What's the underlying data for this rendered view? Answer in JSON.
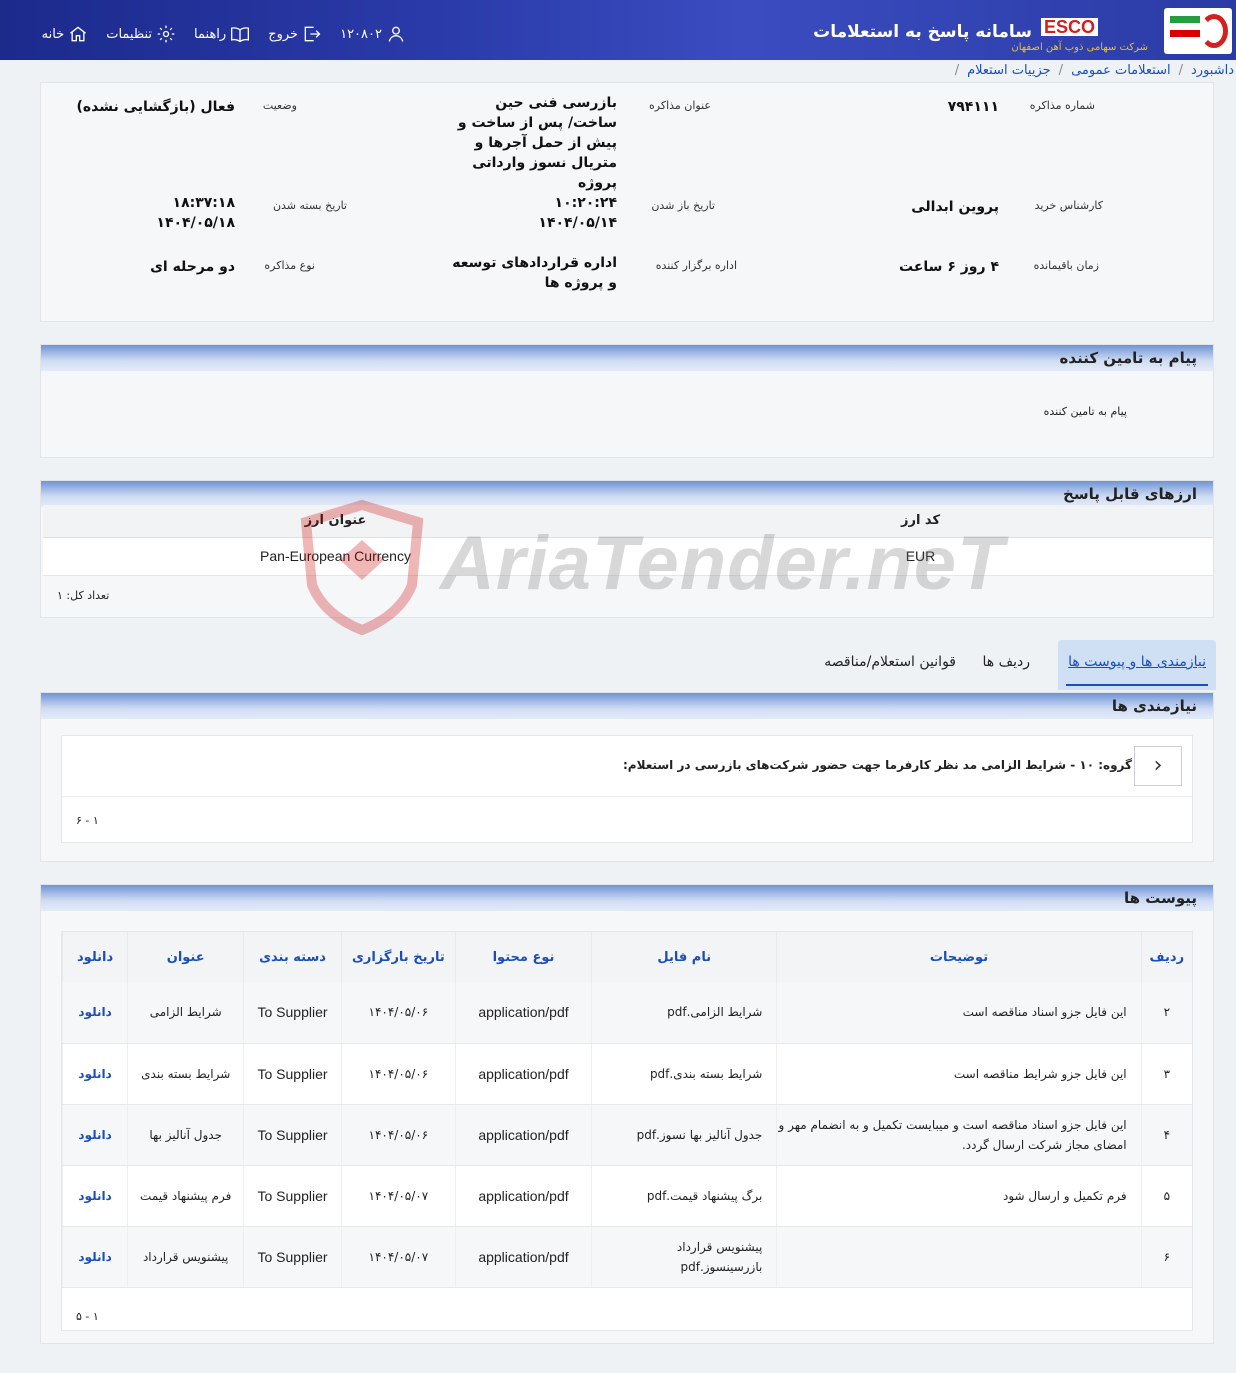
{
  "header": {
    "system_title": "سامانه پاسخ به استعلامات",
    "brand": "ESCO",
    "brand_sub": "شرکت سهامی ذوب آهن اصفهان",
    "nav": {
      "home": "خانه",
      "settings": "تنظیمات",
      "guide": "راهنما",
      "logout": "خروج",
      "user_id": "۱۲۰۸۰۲"
    }
  },
  "breadcrumb": {
    "dashboard": "داشبورد",
    "public": "استعلامات عمومی",
    "detail": "جزییات استعلام"
  },
  "detail": {
    "number_label": "شماره مذاکره",
    "number_value": "۷۹۴۱۱۱",
    "title_label": "عنوان مذاکره",
    "title_value": "بازرسی فنی حین ساخت/ پس از ساخت و پیش از حمل آجرها و متریال نسوز وارداتی پروژه",
    "status_label": "وضعیت",
    "status_value": "فعال (بازگشایی نشده)",
    "expert_label": "کارشناس خرید",
    "expert_value": "پروین ابدالی",
    "open_label": "تاریخ باز شدن",
    "open_time": "۱۰:۲۰:۲۴",
    "open_date": "۱۴۰۴/۰۵/۱۴",
    "close_label": "تاریخ بسته شدن",
    "close_time": "۱۸:۳۷:۱۸",
    "close_date": "۱۴۰۴/۰۵/۱۸",
    "remain_label": "زمان باقیمانده",
    "remain_value": "۴ روز ۶ ساعت",
    "org_label": "اداره برگزار کننده",
    "org_value": "اداره قراردادهای توسعه و پروژه ها",
    "type_label": "نوع مذاکره",
    "type_value": "دو مرحله ای"
  },
  "message": {
    "title": "پیام به تامین کننده",
    "label": "پیام به تامین کننده"
  },
  "currencies": {
    "title": "ارزهای قابل پاسخ",
    "col_code": "کد ارز",
    "col_title": "عنوان ارز",
    "rows": [
      {
        "code": "EUR",
        "title": "Pan-European Currency"
      }
    ],
    "count": "تعداد کل: ۱"
  },
  "tabs": {
    "needs": "نیازمندی ها و پیوست ها",
    "rows": "ردیف ها",
    "rules": "قوانین استعلام/مناقصه"
  },
  "needs": {
    "title": "نیازمندی ها",
    "group": "گروه: ۱۰ - شرایط الزامی مد نظر کارفرما جهت حضور شرکت‌های بازرسی در استعلام:",
    "pager": "۱ - ۶"
  },
  "attachments": {
    "title": "پیوست ها",
    "columns": {
      "row": "ردیف",
      "desc": "توضیحات",
      "name": "نام فایل",
      "mime": "نوع محتوا",
      "date": "تاریخ بارگزاری",
      "cat": "دسته بندی",
      "title": "عنوان",
      "dl": "دانلود"
    },
    "rows": [
      {
        "row": "۲",
        "desc": "این فایل جزو اسناد مناقصه است",
        "name": "شرایط الزامی.pdf",
        "mime": "application/pdf",
        "date": "۱۴۰۴/۰۵/۰۶",
        "cat": "To Supplier",
        "title": "شرایط الزامی",
        "dl": "دانلود"
      },
      {
        "row": "۳",
        "desc": "این فایل جزو شرایط مناقصه است",
        "name": "شرایط بسته بندی.pdf",
        "mime": "application/pdf",
        "date": "۱۴۰۴/۰۵/۰۶",
        "cat": "To Supplier",
        "title": "شرایط بسته بندی",
        "dl": "دانلود"
      },
      {
        "row": "۴",
        "desc": "این فایل جزو اسناد مناقصه است و میبایست تکمیل و به انضمام مهر و امضای مجاز شرکت ارسال گردد.",
        "name": "جدول آنالیز بها نسوز.pdf",
        "mime": "application/pdf",
        "date": "۱۴۰۴/۰۵/۰۶",
        "cat": "To Supplier",
        "title": "جدول آنالیز بها",
        "dl": "دانلود"
      },
      {
        "row": "۵",
        "desc": "فرم تکمیل و ارسال شود",
        "name": "برگ پیشنهاد قیمت.pdf",
        "mime": "application/pdf",
        "date": "۱۴۰۴/۰۵/۰۷",
        "cat": "To Supplier",
        "title": "فرم پیشنهاد قیمت",
        "dl": "دانلود"
      },
      {
        "row": "۶",
        "desc": "",
        "name": "پیشنویس قرارداد بازرسینسوز.pdf",
        "mime": "application/pdf",
        "date": "۱۴۰۴/۰۵/۰۷",
        "cat": "To Supplier",
        "title": "پیشنویس قرارداد",
        "dl": "دانلود"
      }
    ],
    "pager": "۱ - ۵"
  },
  "watermark": "AriaTender.neT"
}
